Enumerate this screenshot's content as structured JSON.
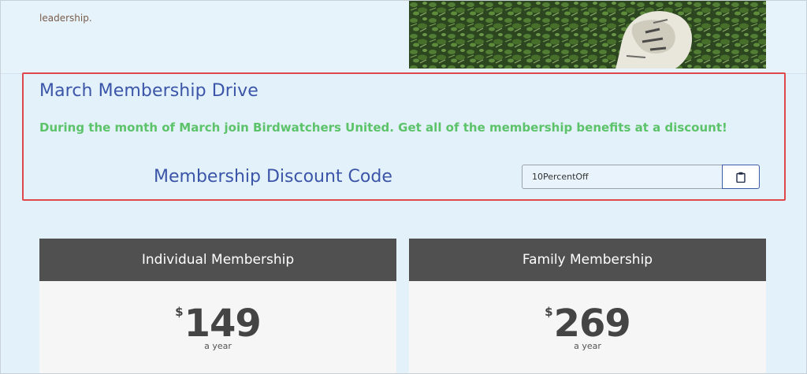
{
  "intro": {
    "line1": "",
    "line2": "leadership."
  },
  "promo": {
    "title": "March Membership Drive",
    "subtitle": "During the month of March join Birdwatchers United.  Get all of the membership benefits at a discount!",
    "code_label": "Membership Discount Code",
    "code_value": "10PercentOff",
    "copy_icon": "clipboard-icon"
  },
  "plans": [
    {
      "name": "Individual Membership",
      "currency": "$",
      "price": "149",
      "period": "a year"
    },
    {
      "name": "Family Membership",
      "currency": "$",
      "price": "269",
      "period": "a year"
    }
  ],
  "colors": {
    "accent": "#3b55a8",
    "highlight_green": "#5cc36a",
    "card_header": "#505050",
    "annotation_red": "#e0474c"
  }
}
